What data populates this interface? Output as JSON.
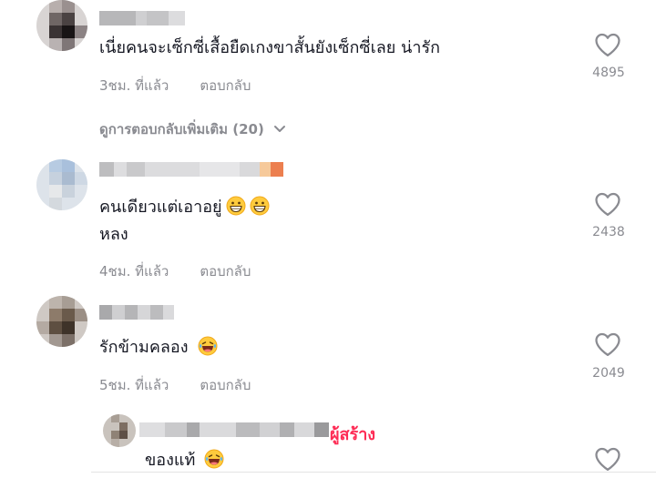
{
  "comments": [
    {
      "text": "เนี่ยคนจะเซ็กซี่เสื้อยืดเกงขาสั้นยังเซ็กซี่เลย น่ารัก",
      "time": "3ชม. ที่แล้ว",
      "reply_label": "ตอบกลับ",
      "likes": "4895",
      "icon": "heart-outline-icon"
    },
    {
      "text_line1": "คนเดียวแต่เอาอยู่",
      "text_line2": "หลง",
      "emoji": [
        "grinning-face-icon",
        "grinning-face-icon"
      ],
      "time": "4ชม. ที่แล้ว",
      "reply_label": "ตอบกลับ",
      "likes": "2438",
      "icon": "heart-outline-icon"
    },
    {
      "text": "รักข้ามคลอง",
      "emoji": [
        "laughing-tears-icon"
      ],
      "time": "5ชม. ที่แล้ว",
      "reply_label": "ตอบกลับ",
      "likes": "2049",
      "icon": "heart-outline-icon"
    }
  ],
  "view_more": {
    "label": "ดูการตอบกลับเพิ่มเติม (20)",
    "icon": "chevron-down-icon"
  },
  "reply": {
    "creator_badge": "ผู้สร้าง",
    "text": "ของแท้",
    "emoji": [
      "laughing-tears-icon"
    ],
    "icon": "heart-outline-icon"
  },
  "colors": {
    "text": "#161823",
    "secondary": "#8a8b91",
    "creator": "#fe2c55"
  }
}
